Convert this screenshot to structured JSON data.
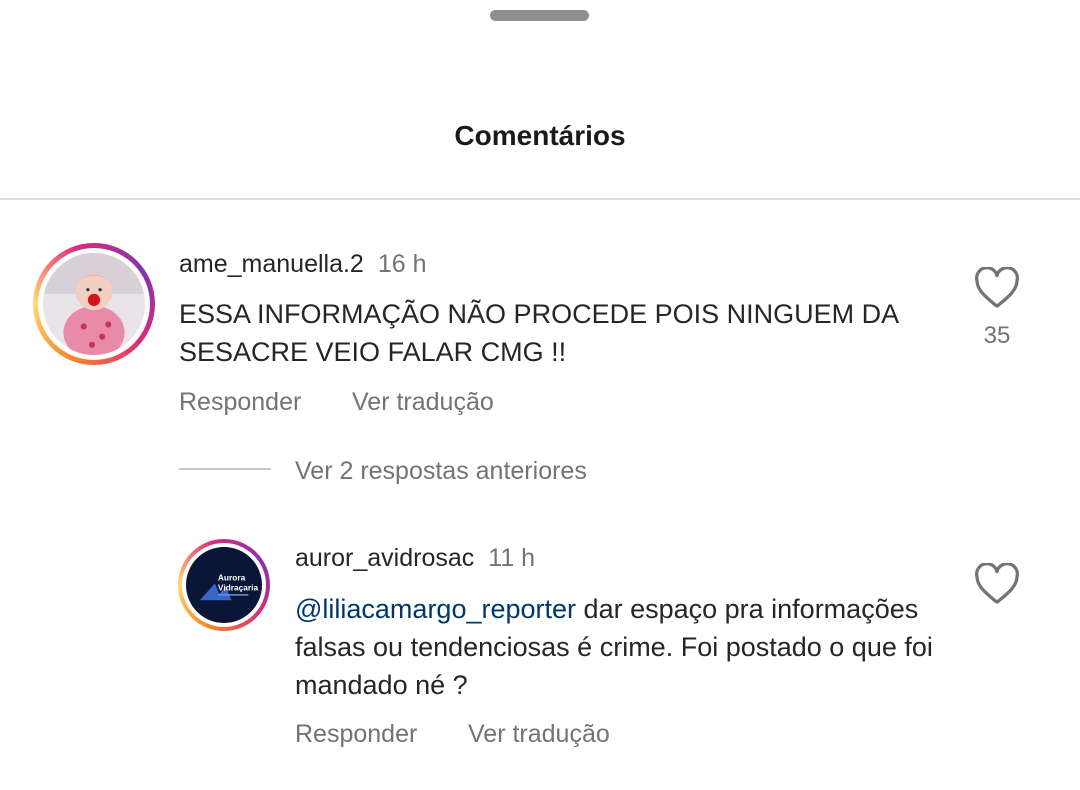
{
  "sheet": {
    "title": "Comentários"
  },
  "comments": [
    {
      "username": "ame_manuella.2",
      "time": "16 h",
      "text": "ESSA INFORMAÇÃO NÃO PROCEDE POIS NINGUEM DA SESACRE VEIO FALAR CMG !!",
      "likes": "35",
      "reply_label": "Responder",
      "translate_label": "Ver tradução",
      "icon": "heart-outline-icon"
    },
    {
      "username": "auror_avidrosac",
      "time": "11 h",
      "mention": "@liliacamargo_reporter",
      "text": "dar espaço pra informações falsas ou tendenciosas é crime. Foi postado o que foi mandado né ?",
      "avatar_text": [
        "Aurora",
        "Vidraçaria"
      ],
      "reply_label": "Responder",
      "translate_label": "Ver tradução",
      "icon": "heart-outline-icon"
    }
  ],
  "replies": {
    "view_previous_label": "Ver 2 respostas anteriores"
  },
  "colors": {
    "text": "#262626",
    "secondary": "#737373",
    "mention": "#00376b",
    "divider": "#dbdbdb"
  }
}
